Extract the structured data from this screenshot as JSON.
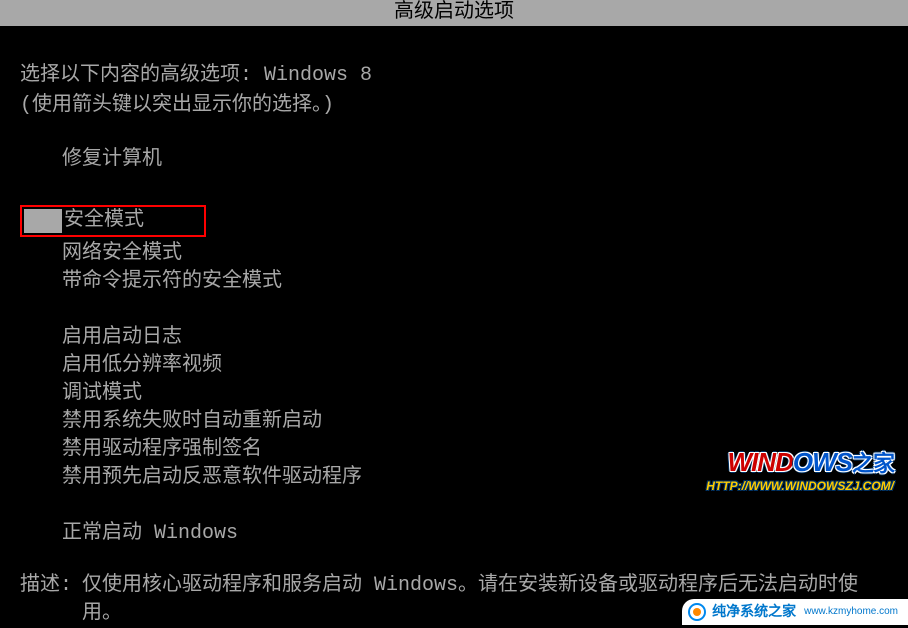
{
  "header": {
    "title": "高级启动选项"
  },
  "prompt": {
    "line1": "选择以下内容的高级选项: Windows 8",
    "line2": "(使用箭头键以突出显示你的选择。)"
  },
  "menu": {
    "group1": [
      "修复计算机"
    ],
    "selected": "安全模式",
    "group2": [
      "网络安全模式",
      "带命令提示符的安全模式"
    ],
    "group3": [
      "启用启动日志",
      "启用低分辨率视频",
      "调试模式",
      "禁用系统失败时自动重新启动",
      "禁用驱动程序强制签名",
      "禁用预先启动反恶意软件驱动程序"
    ],
    "group4": [
      "正常启动 Windows"
    ]
  },
  "description": {
    "label": "描述:",
    "text": "仅使用核心驱动程序和服务启动 Windows。请在安装新设备或驱动程序后无法启动时使用。"
  },
  "watermark1": {
    "brand_left": "WIND",
    "brand_right": "OWS",
    "brand_zh": "之家",
    "url": "HTTP://WWW.WINDOWSZJ.COM/"
  },
  "watermark2": {
    "text": "纯净系统之家",
    "url": "www.kzmyhome.com"
  }
}
